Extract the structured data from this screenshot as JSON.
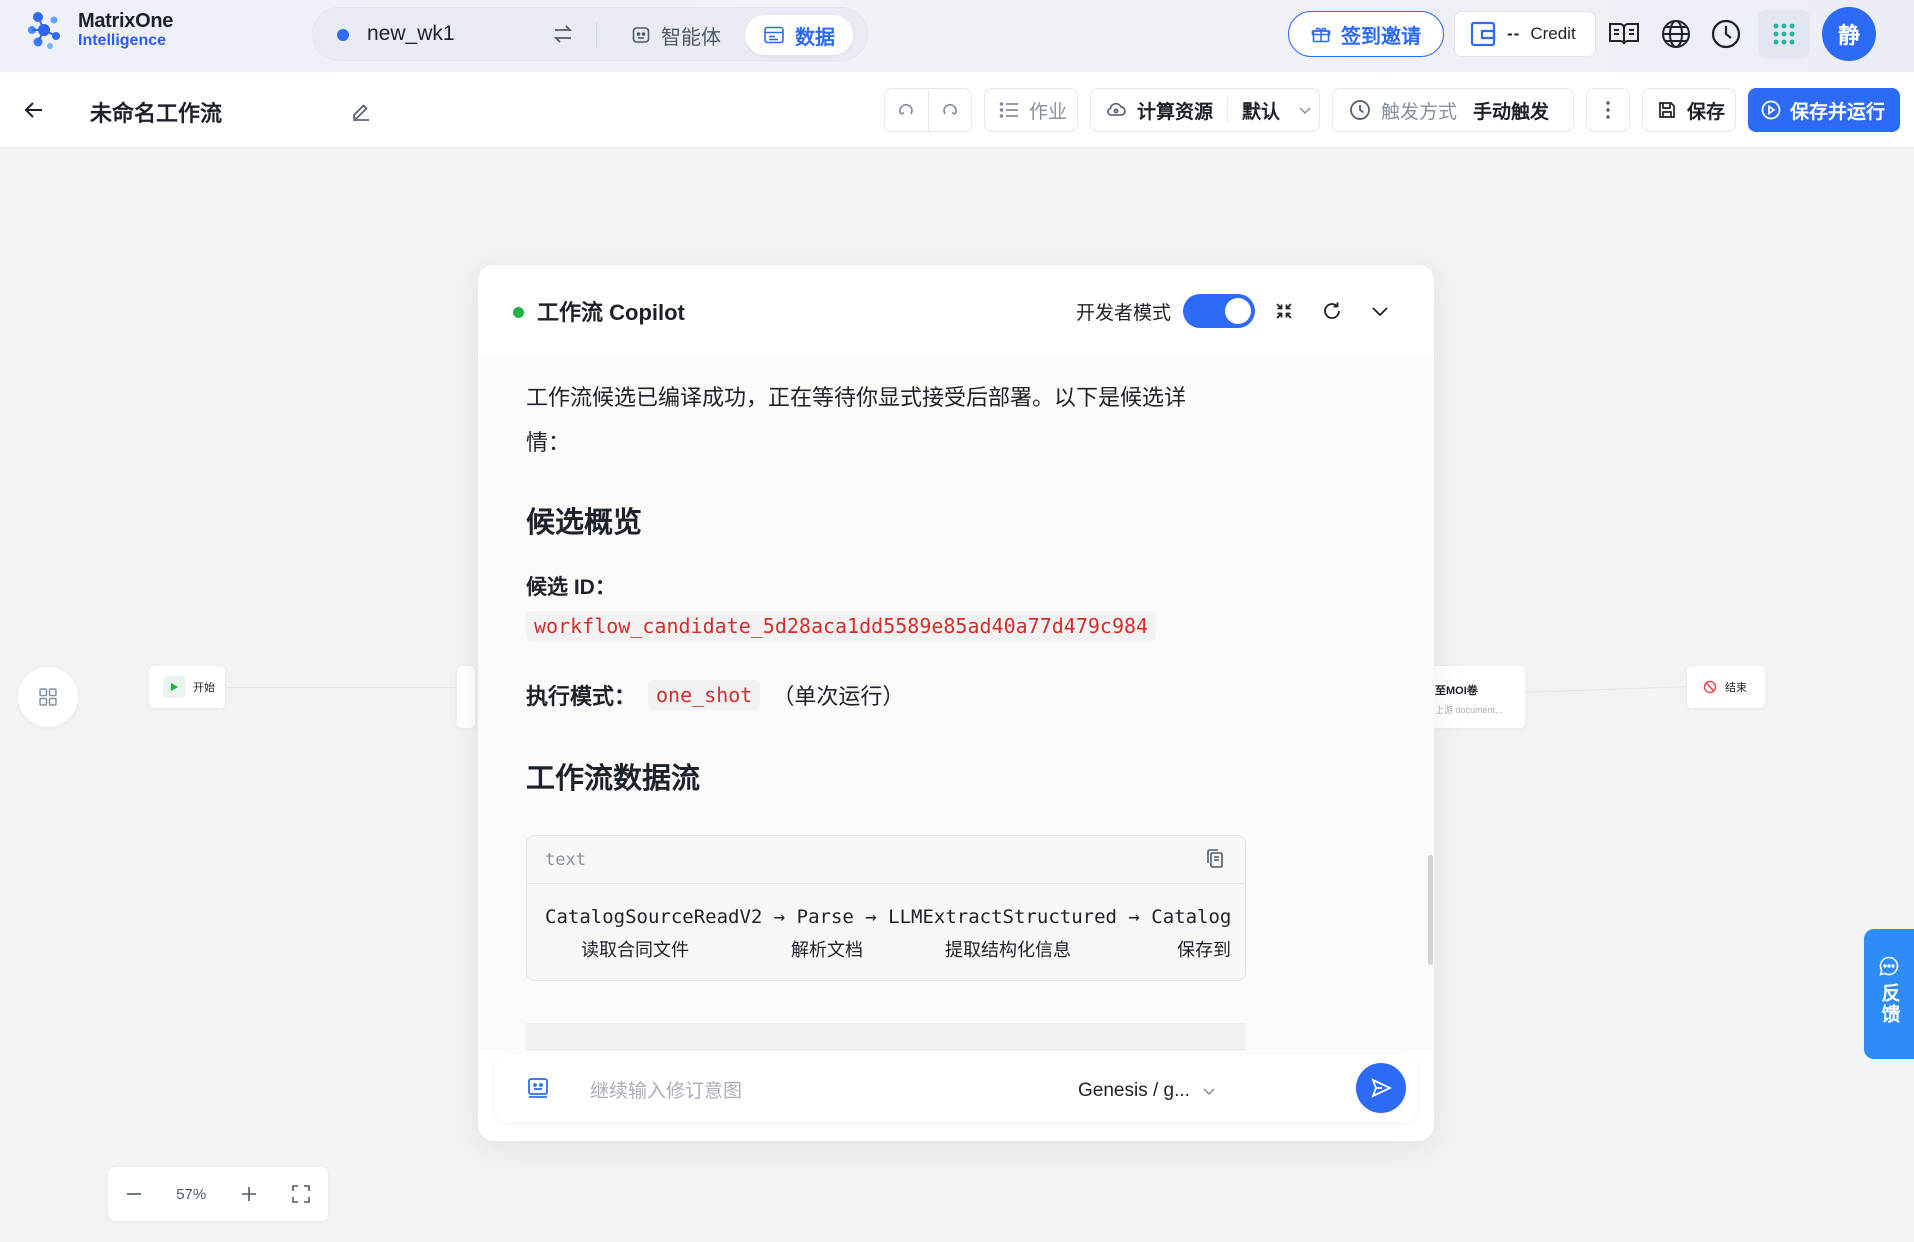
{
  "brand": {
    "line1": "MatrixOne",
    "line2": "Intelligence"
  },
  "workspace": {
    "name": "new_wk1",
    "tabs": [
      {
        "label": "智能体",
        "icon": "agent-icon"
      },
      {
        "label": "数据",
        "icon": "data-icon",
        "active": true
      }
    ]
  },
  "header": {
    "invite_label": "签到邀请",
    "credit_value": "--",
    "credit_label": "Credit",
    "avatar_char": "静",
    "icons": [
      "docs-icon",
      "globe-icon",
      "clock-icon",
      "apps-grid-icon"
    ]
  },
  "toolbar": {
    "title": "未命名工作流",
    "jobs_label": "作业",
    "compute_label": "计算资源",
    "compute_value": "默认",
    "trigger_label": "触发方式",
    "trigger_value": "手动触发",
    "save_label": "保存",
    "save_run_label": "保存并运行"
  },
  "canvas": {
    "nodes": {
      "start_label": "开始",
      "save_node_title": "至MOI卷",
      "save_node_subtitle": "上游 document...",
      "end_label": "结束"
    },
    "zoom_level": "57%",
    "feedback_label": "反馈"
  },
  "copilot": {
    "title": "工作流 Copilot",
    "dev_mode_label": "开发者模式",
    "dev_mode_on": true,
    "intro": "工作流候选已编译成功，正在等待你显式接受后部署。以下是候选详情：",
    "overview_heading": "候选概览",
    "candidate_id_label": "候选 ID：",
    "candidate_id": "workflow_candidate_5d28aca1dd5589e85ad40a77d479c984",
    "exec_mode_label": "执行模式：",
    "exec_mode_value": "one_shot",
    "exec_mode_note": "（单次运行）",
    "flow_heading": "工作流数据流",
    "code_lang": "text",
    "code_line1": "CatalogSourceReadV2 → Parse → LLMExtractStructured → Catalog",
    "code_line2": [
      "读取合同文件",
      "解析文档",
      "提取结构化信息",
      "保存到"
    ],
    "input_placeholder": "继续输入修订意图",
    "model_label": "Genesis / g..."
  },
  "colors": {
    "accent": "#2d6bf6",
    "status_green": "#1db440",
    "code_red": "#d42e2e"
  }
}
